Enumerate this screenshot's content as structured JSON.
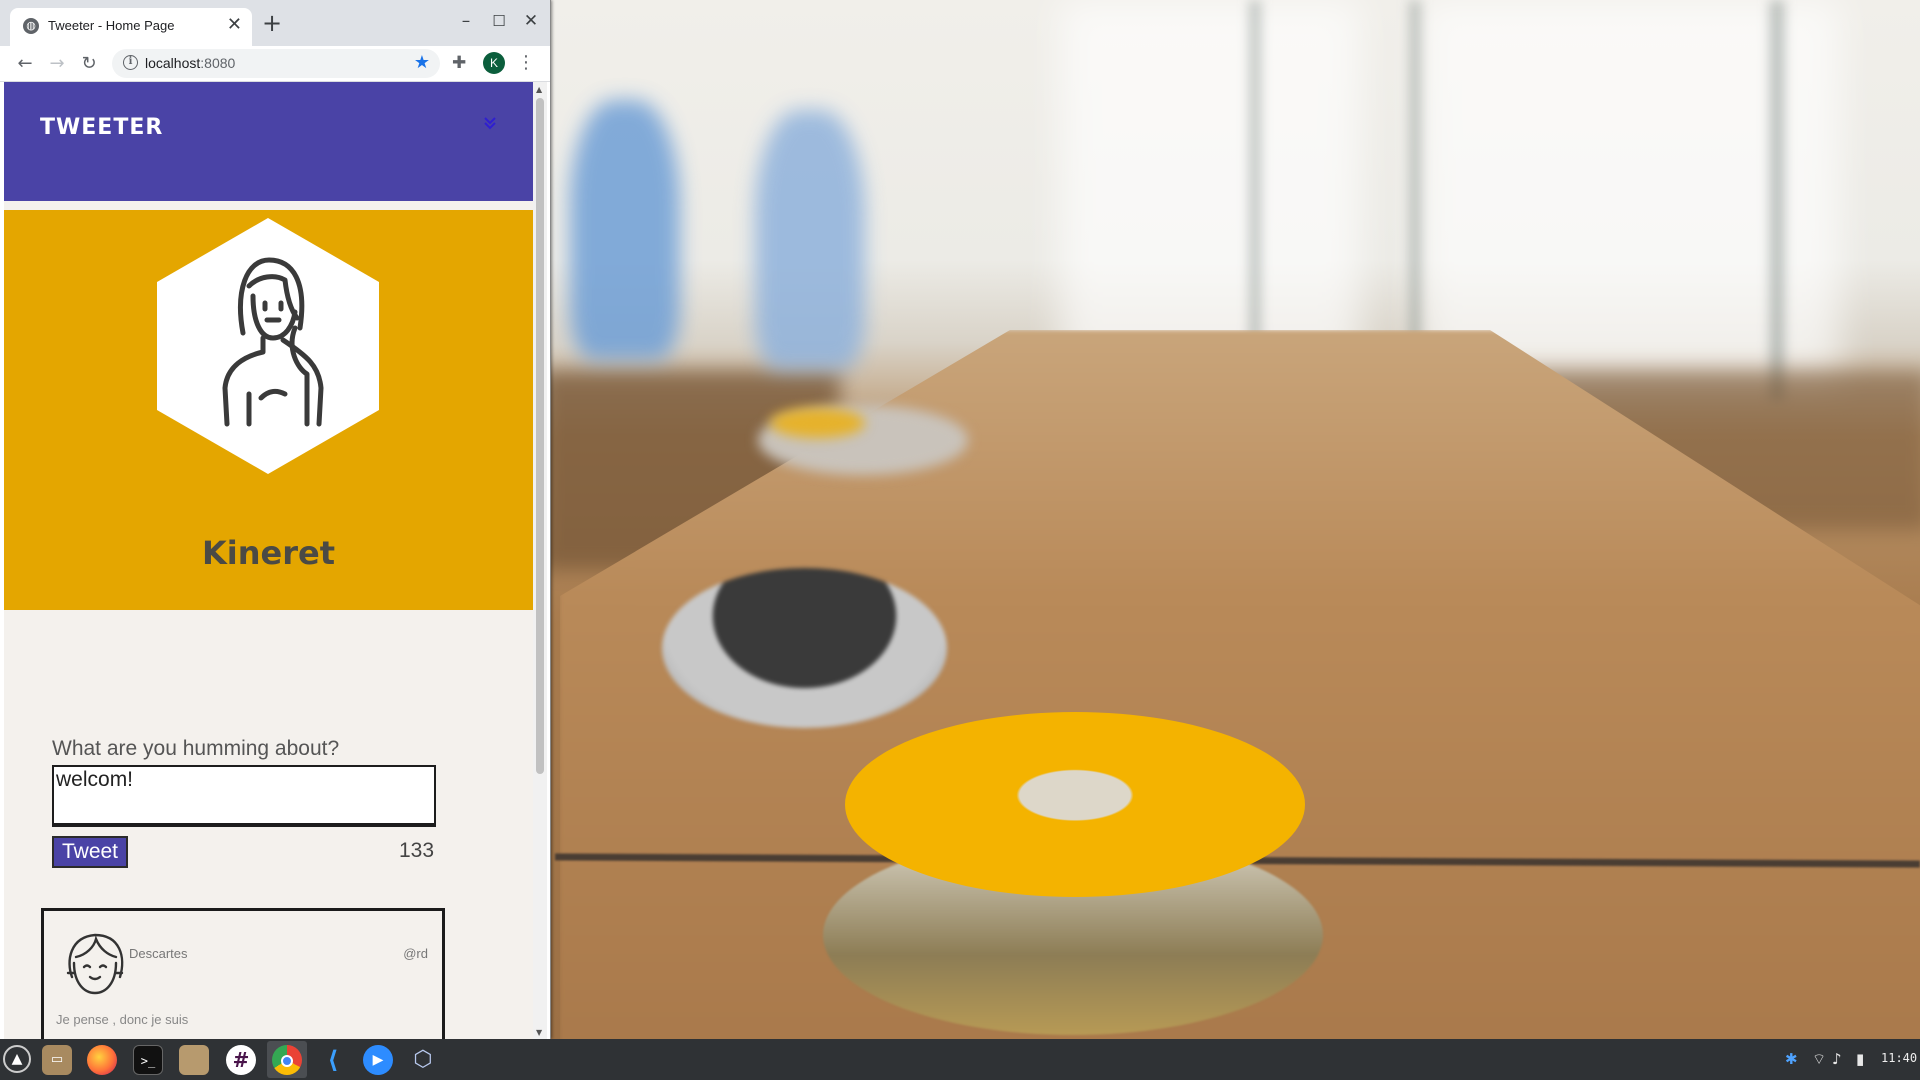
{
  "browser": {
    "tab_title": "Tweeter - Home Page",
    "new_tab_symbol": "+",
    "close_tab_symbol": "✕",
    "url_host": "localhost",
    "url_port": ":8080",
    "profile_initial": "K",
    "window_controls": {
      "minimize": "–",
      "maximize": "☐",
      "close": "✕"
    }
  },
  "site": {
    "brand": "TWEETER",
    "nav_toggle": "⌄",
    "accent_color": "#4a43a6",
    "card_color": "#e4a600"
  },
  "profile": {
    "name": "Kineret"
  },
  "compose": {
    "label": "What are you humming about?",
    "text": "welcom!",
    "button_label": "Tweet",
    "char_count": "133"
  },
  "tweets": [
    {
      "author": "Descartes",
      "handle": "@rd",
      "text": "Je pense , donc je suis"
    }
  ],
  "taskbar": {
    "clock": "11:40",
    "apps": [
      "menu-icon",
      "files-icon",
      "firefox-icon",
      "terminal-icon",
      "folder-icon",
      "slack-icon",
      "chrome-icon",
      "vscode-icon",
      "zoom-icon",
      "virtualbox-icon"
    ],
    "tray": [
      "bluetooth-icon",
      "wifi-icon",
      "volume-icon",
      "battery-icon"
    ]
  }
}
